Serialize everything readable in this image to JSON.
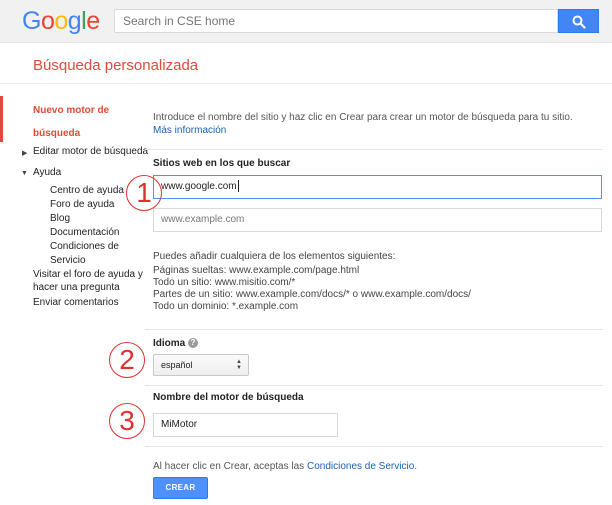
{
  "header": {
    "logo_letters": [
      "G",
      "o",
      "o",
      "g",
      "l",
      "e"
    ],
    "search_placeholder": "Search in CSE home",
    "search_icon": "magnifier-icon",
    "page_title": "Búsqueda personalizada"
  },
  "sidebar": {
    "active_item": "Nuevo motor de búsqueda",
    "active_lines": [
      "Nuevo motor de",
      "búsqueda"
    ],
    "edit_item": "Editar motor de búsqueda",
    "help_item": "Ayuda",
    "help_subitems": [
      "Centro de ayuda",
      "Foro de ayuda",
      "Blog",
      "Documentación",
      "Condiciones de Servicio"
    ],
    "forum_link": "Visitar el foro de ayuda y hacer una pregunta",
    "feedback_link": "Enviar comentarios"
  },
  "main": {
    "intro_text": "Introduce el nombre del sitio y haz clic en Crear para crear un motor de búsqueda para tu sitio.",
    "intro_link": "Más información",
    "sites_label": "Sitios web en los que buscar",
    "site_value": "www.google.com",
    "site_placeholder": "www.example.com",
    "hint_title": "Puedes añadir cualquiera de los elementos siguientes:",
    "hint_lines": [
      "Páginas sueltas: www.example.com/page.html",
      "Todo un sitio: www.misitio.com/*",
      "Partes de un sitio: www.example.com/docs/* o www.example.com/docs/",
      "Todo un dominio: *.example.com"
    ],
    "language_label": "Idioma",
    "language_value": "español",
    "name_label": "Nombre del motor de búsqueda",
    "name_value": "MiMotor",
    "terms_prefix": "Al hacer clic en Crear, aceptas las",
    "terms_link": "Condiciones de Servicio",
    "terms_suffix": ".",
    "create_button": "CREAR"
  },
  "annotations": {
    "step1": "1",
    "step2": "2",
    "step3": "3",
    "color": "#e03030"
  },
  "colors": {
    "brand_red": "#dd4b39",
    "button_blue": "#4d90fe",
    "link_blue": "#1a5fb4"
  }
}
